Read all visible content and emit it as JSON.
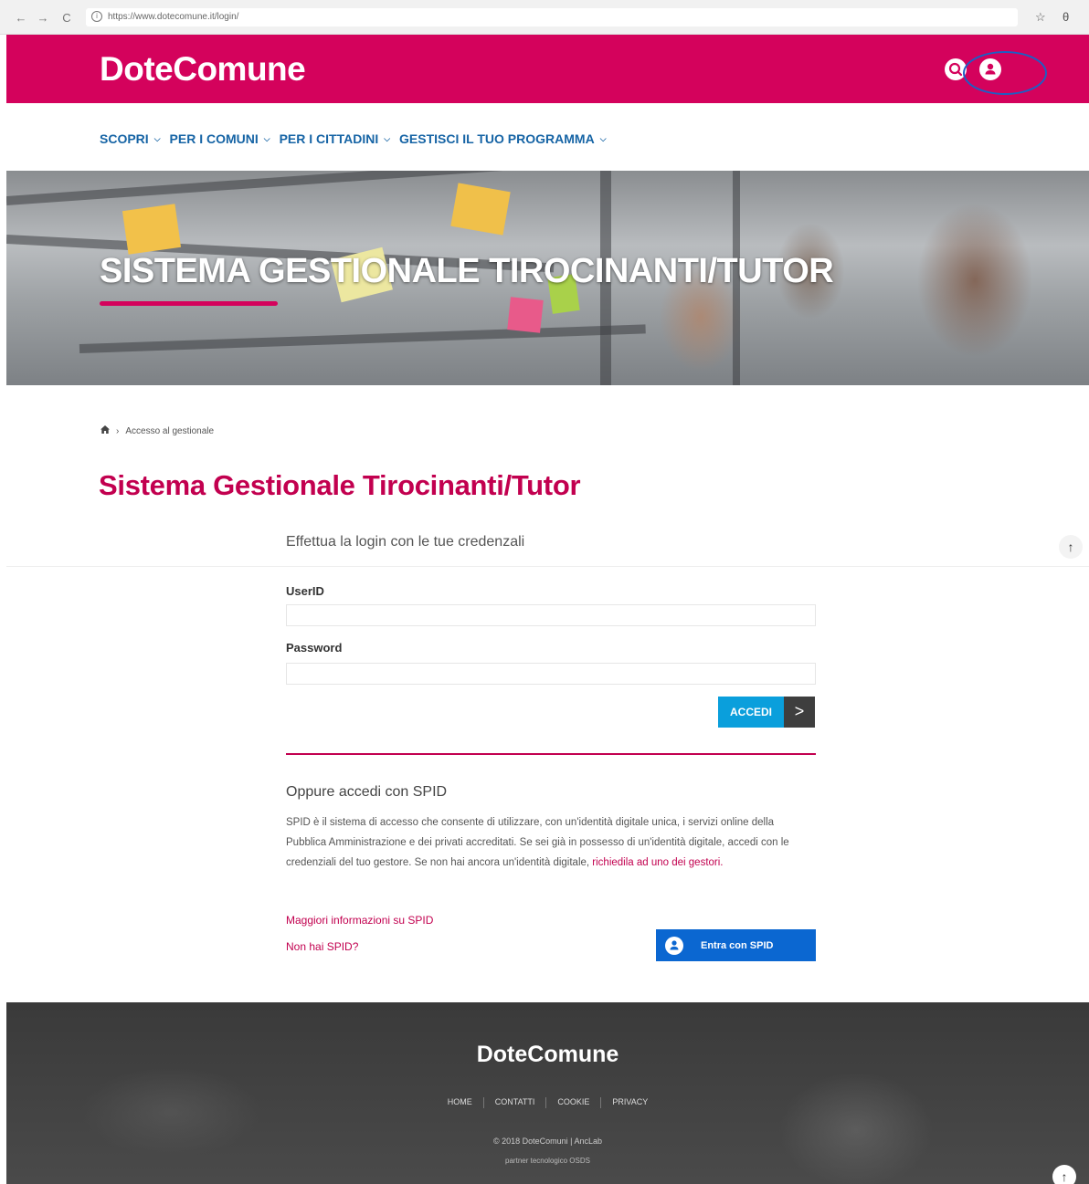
{
  "browser": {
    "back": "←",
    "forward": "→",
    "reload": "C",
    "url": "https://www.dotecomune.it/login/",
    "star": "☆",
    "account": "θ"
  },
  "header": {
    "logo": "DoteComune",
    "search_icon": "search-icon",
    "user_icon": "user-icon",
    "brand_color": "#d4025c"
  },
  "nav": {
    "items": [
      {
        "label": "SCOPRI"
      },
      {
        "label": "PER I COMUNI"
      },
      {
        "label": "PER I CITTADINI"
      },
      {
        "label": "GESTISCI IL TUO PROGRAMMA"
      }
    ]
  },
  "hero": {
    "title": "SISTEMA GESTIONALE TIROCINANTI/TUTOR"
  },
  "breadcrumb": {
    "current": "Accesso al gestionale"
  },
  "page": {
    "title": "Sistema Gestionale Tirocinanti/Tutor"
  },
  "login": {
    "heading": "Effettua la login con le tue credenzali",
    "userid_label": "UserID",
    "userid_value": "",
    "password_label": "Password",
    "password_value": "",
    "submit_label": "ACCEDI",
    "submit_arrow": ">"
  },
  "spid": {
    "heading": "Oppure accedi con SPID",
    "description": "SPID è il sistema di accesso che consente di utilizzare, con un'identità digitale unica, i servizi online della Pubblica Amministrazione e dei privati accreditati. Se sei già in possesso di un'identità digitale, accedi con le credenziali del tuo gestore. Se non hai ancora un'identità digitale,",
    "request_link": "richiedila ad uno dei gestori.",
    "more_info_link": "Maggiori informazioni su SPID",
    "no_spid_link": "Non hai SPID?",
    "button_label": "Entra con SPID",
    "button_color": "#0b67d1"
  },
  "footer": {
    "logo": "DoteComune",
    "links": [
      {
        "label": "HOME"
      },
      {
        "label": "CONTATTI"
      },
      {
        "label": "COOKIE"
      },
      {
        "label": "PRIVACY"
      }
    ],
    "copyright": "© 2018 DoteComuni | AncLab",
    "partner": "partner tecnologico OSDS"
  },
  "scroll": {
    "up_icon": "↑"
  }
}
